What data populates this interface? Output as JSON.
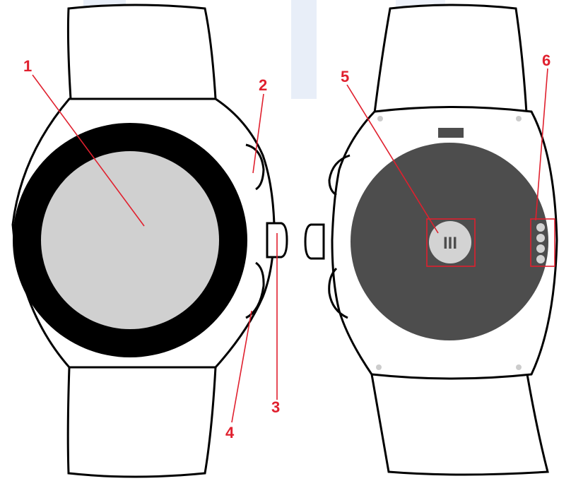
{
  "colors": {
    "outline": "#000000",
    "band_fill": "#ffffff",
    "bezel": "#000000",
    "screen": "#d0d0d0",
    "back_plate": "#4d4d4d",
    "sensor": "#d3d3d3",
    "callout": "#e0202e",
    "bg_stripe": "#e8eef8"
  },
  "callouts": [
    {
      "id": "1",
      "label": "1",
      "part": "screen"
    },
    {
      "id": "2",
      "label": "2",
      "part": "upper-side-button"
    },
    {
      "id": "3",
      "label": "3",
      "part": "crown"
    },
    {
      "id": "4",
      "label": "4",
      "part": "lower-side-button"
    },
    {
      "id": "5",
      "label": "5",
      "part": "heart-rate-sensor"
    },
    {
      "id": "6",
      "label": "6",
      "part": "charging-contacts"
    }
  ],
  "sensor_text": "III"
}
